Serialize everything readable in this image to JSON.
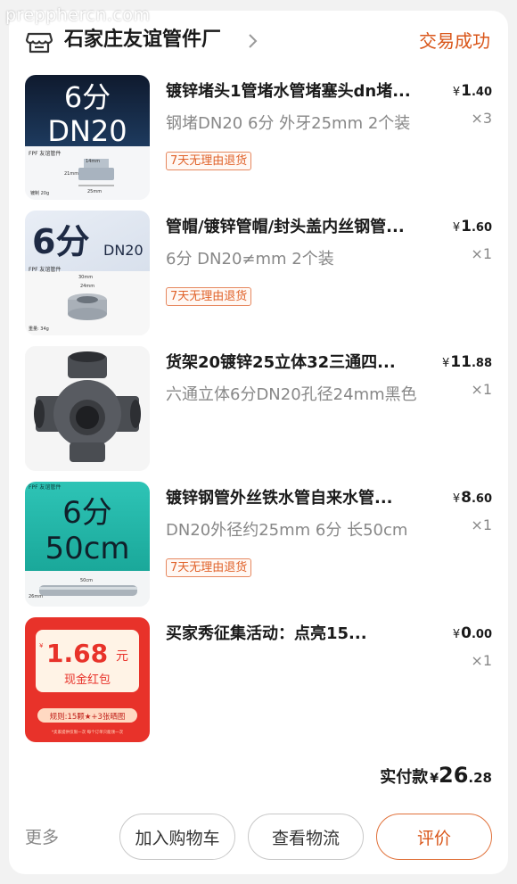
{
  "watermark": "prepphercn.com",
  "shop": {
    "name": "石家庄友谊管件厂",
    "icon": "store-icon",
    "status": "交易成功"
  },
  "items": [
    {
      "title": "镀锌堵头1管堵水管堵塞头dn堵...",
      "spec": "钢堵DN20 6分 外牙25mm 2个装",
      "tag": "7天无理由退货",
      "price": {
        "currency": "¥",
        "int": "1",
        "dec": ".40"
      },
      "qty": "×3",
      "thumb": {
        "big": "6分",
        "sub": "DN20",
        "brand": "FPF 友谊管件",
        "dims": [
          "14mm",
          "21mm",
          "25mm"
        ],
        "note": "镀制 20g"
      }
    },
    {
      "title": "管帽/镀锌管帽/封头盖内丝钢管...",
      "spec": "6分 DN20≠mm 2个装",
      "tag": "7天无理由退货",
      "price": {
        "currency": "¥",
        "int": "1",
        "dec": ".60"
      },
      "qty": "×1",
      "thumb": {
        "big": "6分",
        "sub": "DN20",
        "brand": "FPF 友谊管件",
        "dims": [
          "30mm",
          "24mm"
        ],
        "note": "重量: 34g"
      }
    },
    {
      "title": "货架20镀锌25立体32三通四...",
      "spec": "六通立体6分DN20孔径24mm黑色",
      "tag": "",
      "price": {
        "currency": "¥",
        "int": "11",
        "dec": ".88"
      },
      "qty": "×1",
      "thumb": {}
    },
    {
      "title": "镀锌钢管外丝铁水管自来水管...",
      "spec": "DN20外径约25mm 6分 长50cm",
      "tag": "7天无理由退货",
      "price": {
        "currency": "¥",
        "int": "8",
        "dec": ".60"
      },
      "qty": "×1",
      "thumb": {
        "big": "6分",
        "sub": "50cm",
        "brand": "FPF 友谊管件",
        "dims": [
          "50cm",
          "26mm"
        ]
      }
    },
    {
      "title": "买家秀征集活动：点亮15...",
      "spec": "",
      "tag": "",
      "price": {
        "currency": "¥",
        "int": "0",
        "dec": ".00"
      },
      "qty": "×1",
      "thumb": {
        "amount": "1.68",
        "unit": "元",
        "label": "现金红包",
        "rule": "规则:15颗★+3张晒图",
        "footer": "*卖家提供仅限一次  每个订单只能领一次"
      }
    }
  ],
  "total": {
    "label": "实付款",
    "currency": "¥",
    "int": "26",
    "dec": ".28"
  },
  "actions": {
    "more": "更多",
    "cart": "加入购物车",
    "logistics": "查看物流",
    "review": "评价"
  },
  "colors": {
    "accent": "#d9561a",
    "tag": "#e0622a",
    "redpacket": "#e8322a"
  }
}
